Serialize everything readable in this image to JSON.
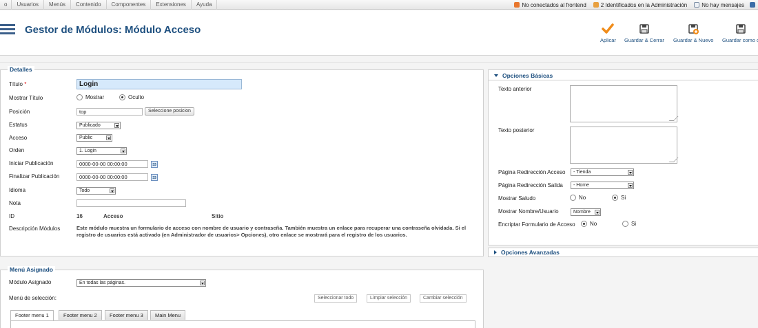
{
  "menubar": {
    "items": [
      "o",
      "Usuarios",
      "Menús",
      "Contenido",
      "Componentes",
      "Extensiones",
      "Ayuda"
    ],
    "status": [
      {
        "text": "No conectados al frontend",
        "icon": "users-offline-icon",
        "color": "#e8772e"
      },
      {
        "text": "2 Identificados en la Administración",
        "icon": "users-logged-icon",
        "color": "#e8a040"
      },
      {
        "text": "No hay mensajes",
        "icon": "messages-icon",
        "color": "#7d8fa6"
      }
    ]
  },
  "header": {
    "title": "Gestor de Módulos: Módulo Acceso",
    "title_color": "#1d4f7f",
    "toolbar": {
      "apply": "Aplicar",
      "save_close": "Guardar & Cerrar",
      "save_new": "Guardar & Nuevo",
      "save_copy": "Guardar como c"
    }
  },
  "details": {
    "legend": "Detalles",
    "title_label": "Título",
    "title_required": "*",
    "title_value": "Login",
    "show_title_label": "Mostrar Título",
    "show_title_options": [
      "Mostrar",
      "Oculto"
    ],
    "show_title_selected": "Oculto",
    "position_label": "Posición",
    "position_value": "top",
    "position_button": "Seleccione posicion",
    "status_label": "Estatus",
    "status_value": "Publicado",
    "access_label": "Acceso",
    "access_value": "Public",
    "order_label": "Orden",
    "order_value": "1. Login",
    "publish_up_label": "Iniciar Publicación",
    "publish_up_value": "0000-00-00 00:00:00",
    "publish_down_label": "Finalizar Publicación",
    "publish_down_value": "0000-00-00 00:00:00",
    "calendar_text": "33",
    "language_label": "Idioma",
    "language_value": "Todo",
    "note_label": "Nota",
    "note_value": "",
    "id_label": "ID",
    "id_value": "16",
    "id_module": "Acceso",
    "id_client": "Sitio",
    "desc_label": "Descripción Módulos",
    "desc_text": "Este módulo muestra un formulario de acceso con nombre de usuario y contraseña. También muestra un enlace para recuperar una contraseña olvidada. Si el registro de usuarios está activado (en Administrador de usuarios> Opciones), otro enlace se mostrará para el registro de los usuarios."
  },
  "basic_options": {
    "header": "Opciones Básicas",
    "pretext_label": "Texto anterior",
    "posttext_label": "Texto posterior",
    "login_redirect_label": "Página Redirección Acceso",
    "login_redirect_value": "- Tienda",
    "logout_redirect_label": "Página Redirección Salida",
    "logout_redirect_value": "- Home",
    "greeting_label": "Mostrar Saludo",
    "greeting_options": [
      "No",
      "Si"
    ],
    "greeting_selected": "Si",
    "name_label": "Mostrar Nombre/Usuario",
    "name_value": "Nombre",
    "encrypt_label": "Encriptar Formulario de Acceso",
    "encrypt_options": [
      "No",
      "Si"
    ],
    "encrypt_selected": "No"
  },
  "advanced_options": {
    "header": "Opciones Avanzadas"
  },
  "menu_assignment": {
    "legend": "Menú Asignado",
    "module_label": "Módulo Asignado",
    "module_value": "En todas las páginas.",
    "selection_label": "Menú de selección:",
    "btn_select_all": "Seleccionar todo",
    "btn_clear": "Limpiar selección",
    "btn_toggle": "Cambiar selección",
    "tabs": [
      "Footer menu 1",
      "Footer menu 2",
      "Footer menu 3",
      "Main Menu"
    ],
    "active_tab": "Footer menu 1"
  }
}
